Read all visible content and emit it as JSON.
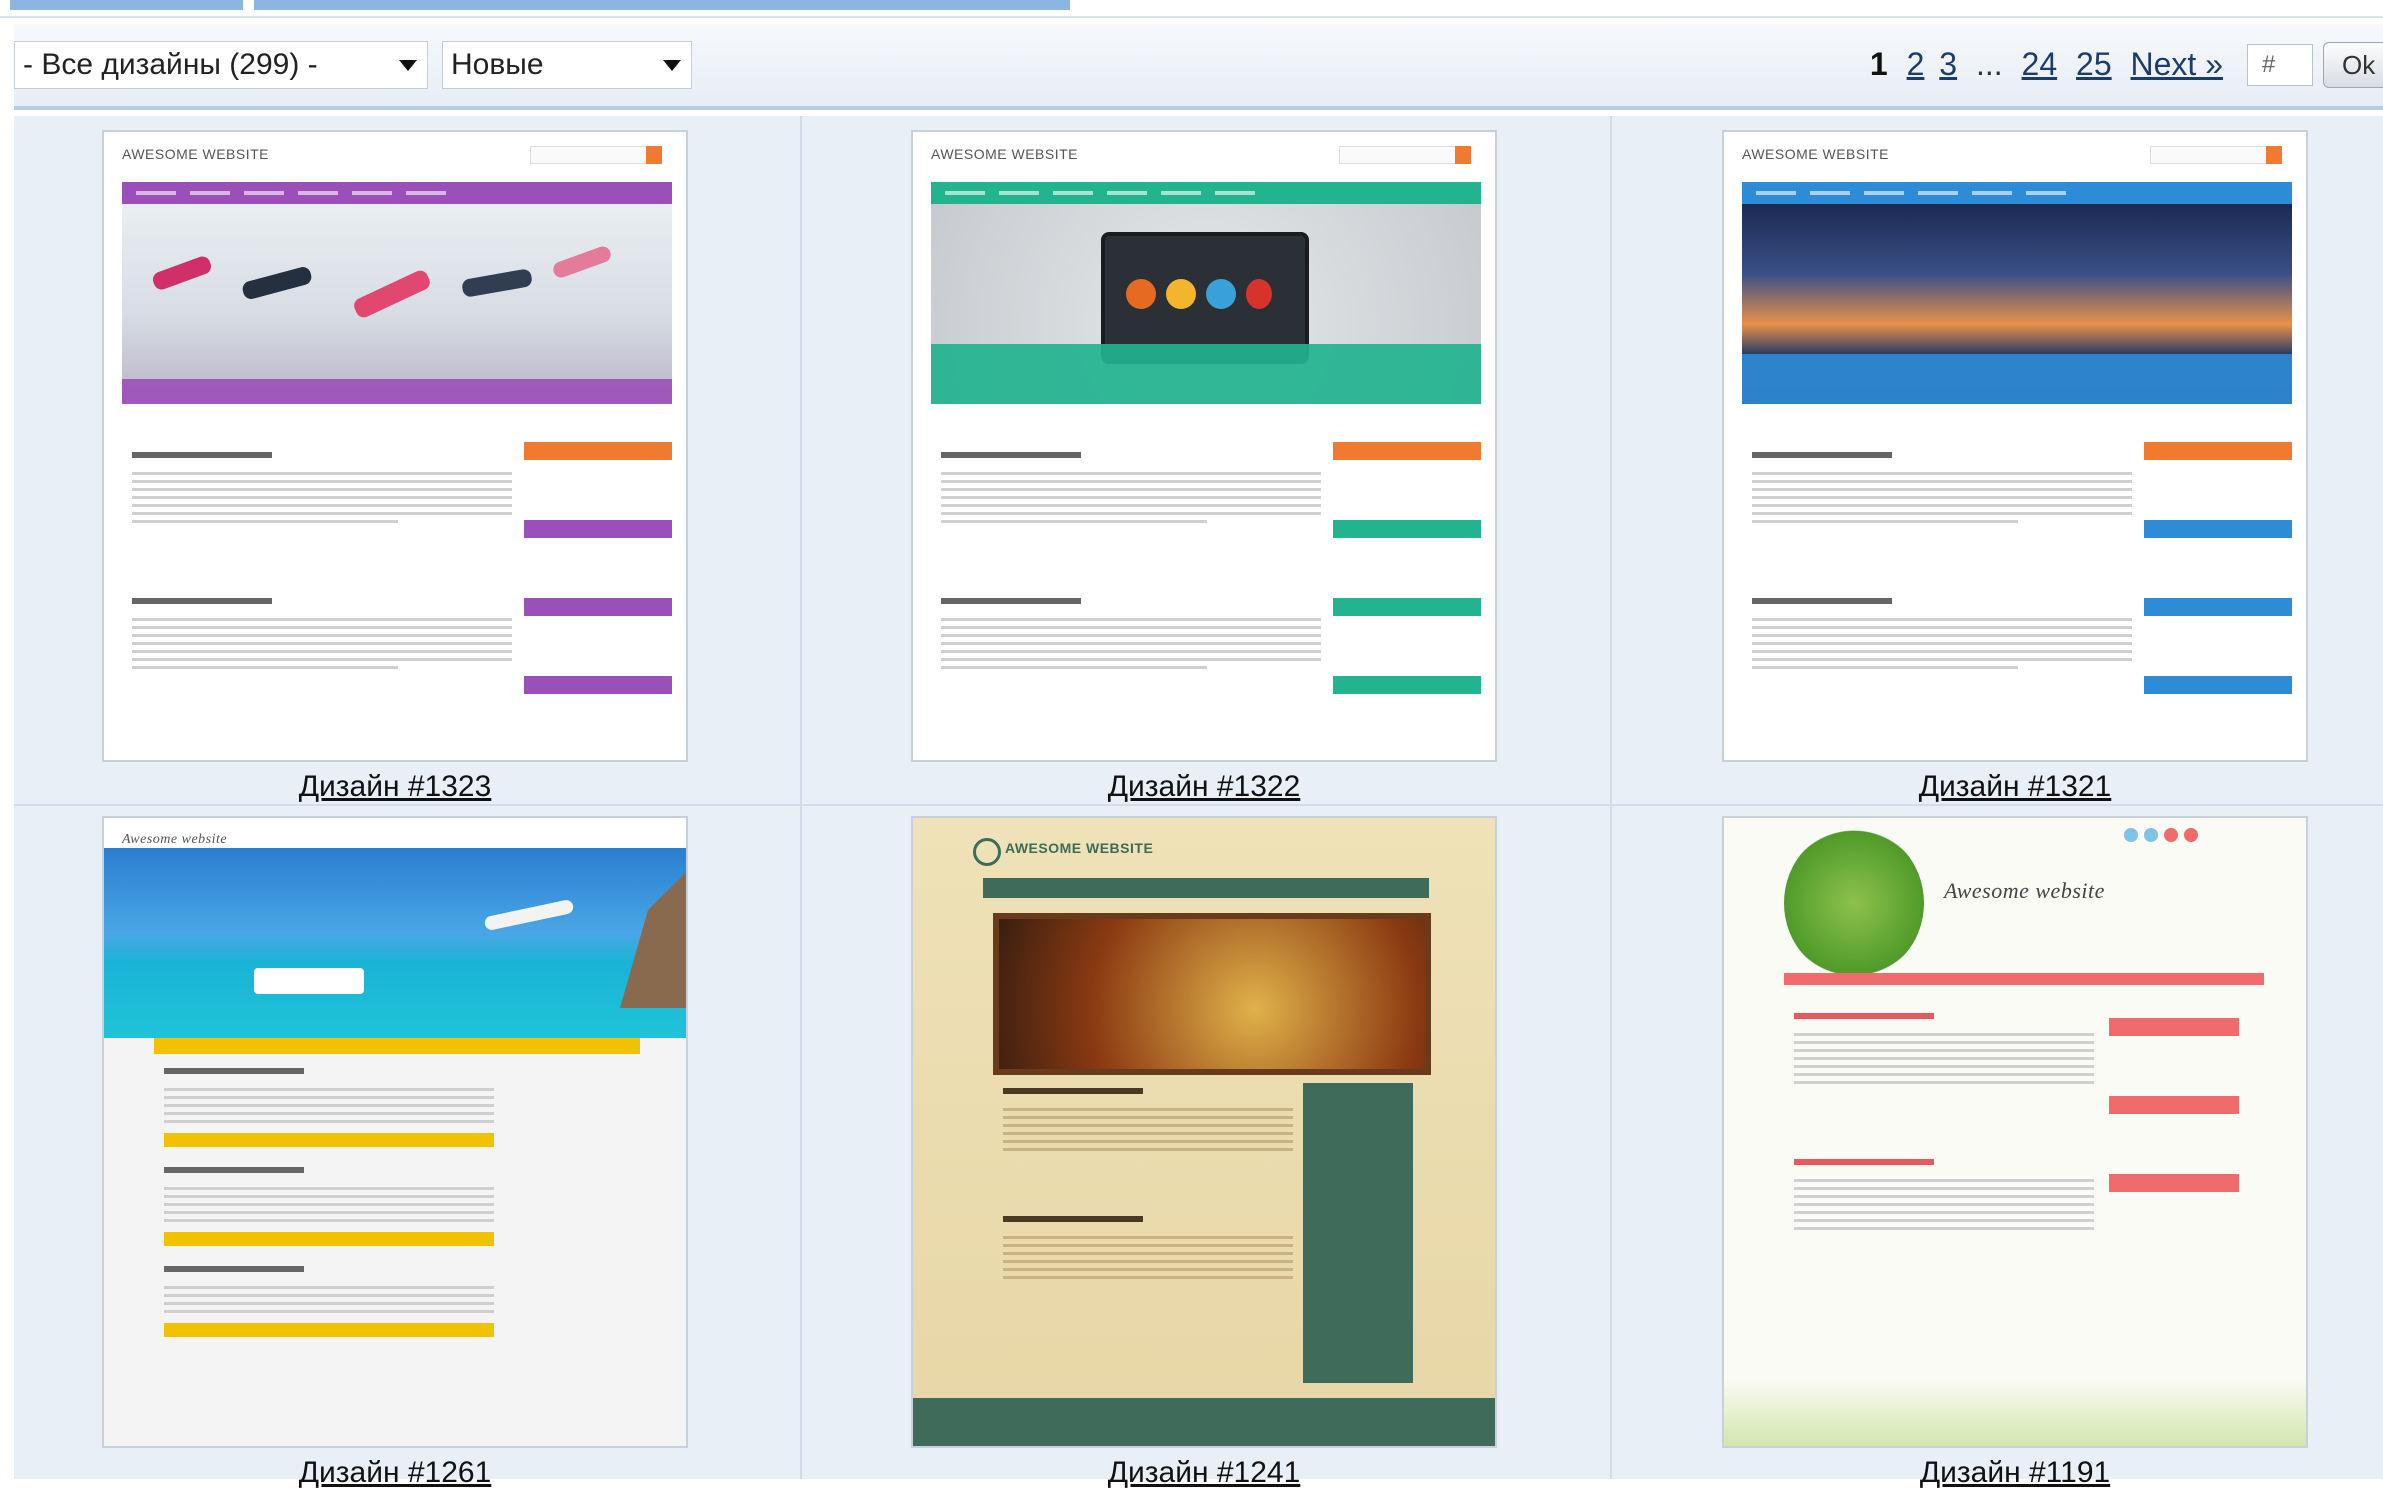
{
  "filters": {
    "category": "- Все дизайны (299) -",
    "sort": "Новые"
  },
  "pagination": {
    "current": "1",
    "pages": [
      "2",
      "3"
    ],
    "ellipsis": "...",
    "last_pages": [
      "24",
      "25"
    ],
    "next": "Next »",
    "goto_placeholder": "#",
    "ok": "Ok"
  },
  "designs": [
    {
      "caption": "Дизайн #1323",
      "logo": "AWESOME WEBSITE",
      "accent": "#9b4fb8",
      "theme": "fitness"
    },
    {
      "caption": "Дизайн #1322",
      "logo": "AWESOME WEBSITE",
      "accent": "#22b38f",
      "theme": "laptop"
    },
    {
      "caption": "Дизайн #1321",
      "logo": "AWESOME WEBSITE",
      "accent": "#2e8bd6",
      "theme": "sunset"
    },
    {
      "caption": "Дизайн #1261",
      "logo": "Awesome website",
      "accent": "#f2c200",
      "theme": "sea"
    },
    {
      "caption": "Дизайн #1241",
      "logo": "AWESOME WEBSITE",
      "accent": "#3f6b5a",
      "theme": "vintage"
    },
    {
      "caption": "Дизайн #1191",
      "logo": "Awesome website",
      "accent": "#f06b6b",
      "theme": "nature"
    }
  ]
}
